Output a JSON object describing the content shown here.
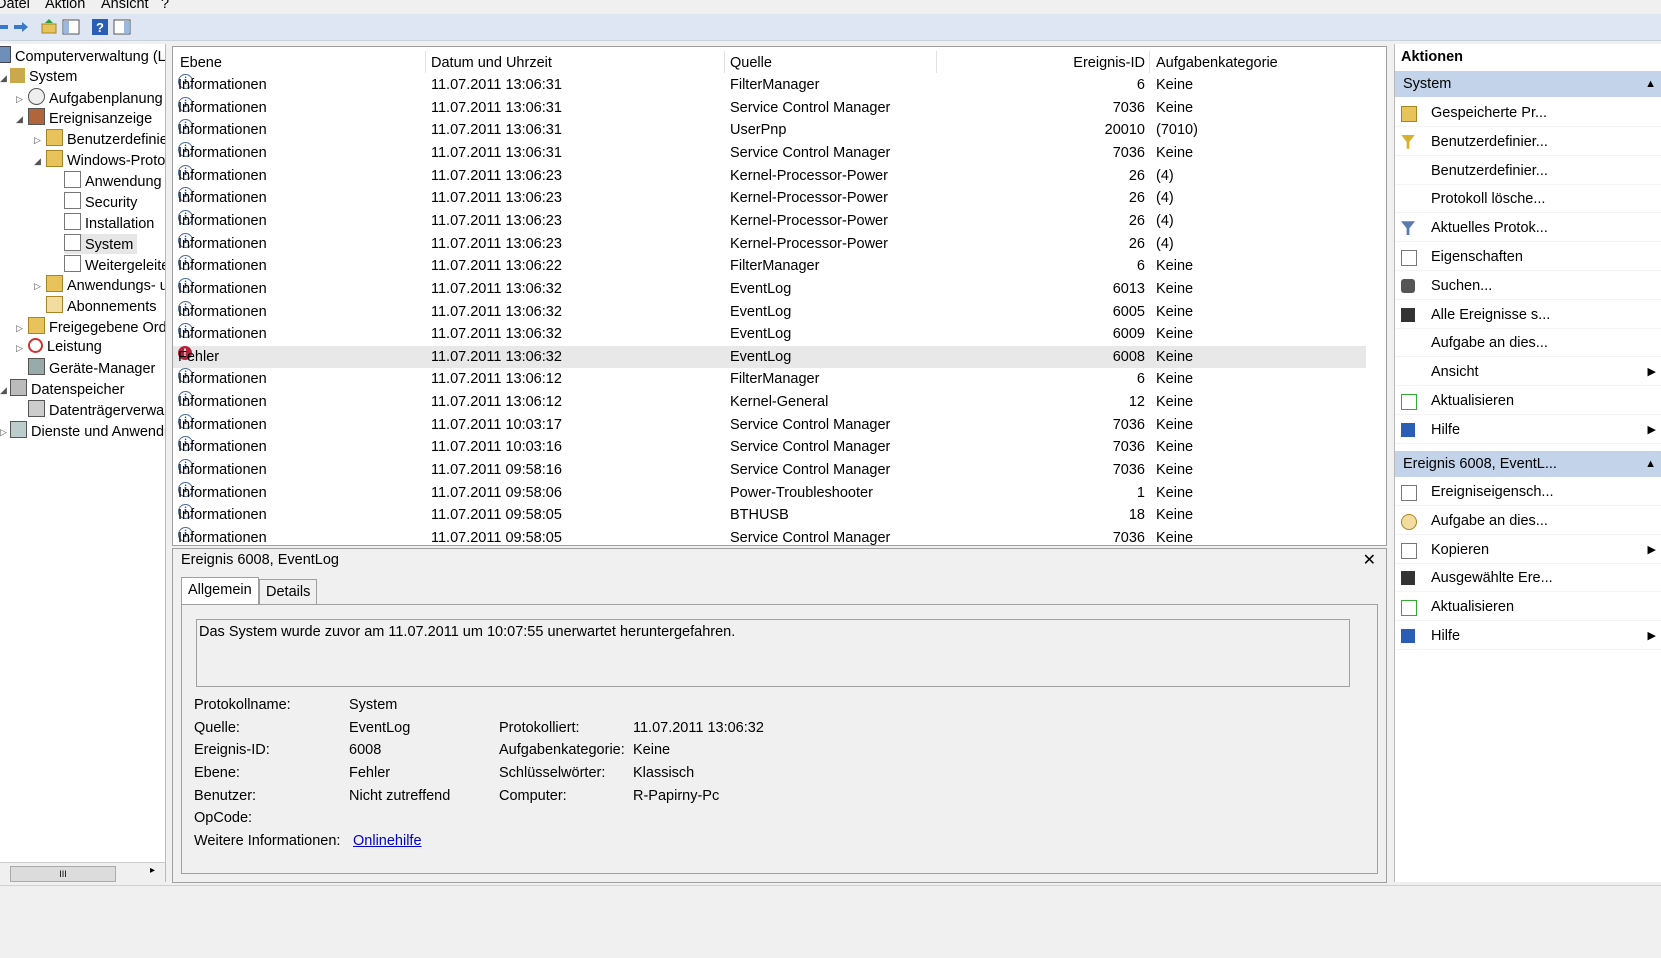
{
  "menu": {
    "file": "Datei",
    "action": "Aktion",
    "view": "Ansicht",
    "help": "?"
  },
  "tree": {
    "root": "Computerverwaltung (Lc",
    "system": "System",
    "task_scheduler": "Aufgabenplanung",
    "event_viewer": "Ereignisanzeige",
    "custom_views": "Benutzerdefinie",
    "windows_logs": "Windows-Protol",
    "application": "Anwendung",
    "security": "Security",
    "installation": "Installation",
    "system_log": "System",
    "forwarded": "Weitergeleite",
    "app_services": "Anwendungs- u",
    "subscriptions": "Abonnements",
    "shared_folders": "Freigegebene Ordr",
    "performance": "Leistung",
    "device_manager": "Geräte-Manager",
    "storage": "Datenspeicher",
    "disk_mgmt": "Datenträgerverwal",
    "services": "Dienste und Anwendu"
  },
  "list": {
    "columns": {
      "level": "Ebene",
      "datetime": "Datum und Uhrzeit",
      "source": "Quelle",
      "event_id": "Ereignis-ID",
      "task_category": "Aufgabenkategorie"
    },
    "rows": [
      {
        "level": "Informationen",
        "type": "info",
        "datetime": "11.07.2011 13:06:31",
        "source": "FilterManager",
        "id": "6",
        "category": "Keine"
      },
      {
        "level": "Informationen",
        "type": "info",
        "datetime": "11.07.2011 13:06:31",
        "source": "Service Control Manager",
        "id": "7036",
        "category": "Keine"
      },
      {
        "level": "Informationen",
        "type": "info",
        "datetime": "11.07.2011 13:06:31",
        "source": "UserPnp",
        "id": "20010",
        "category": "(7010)"
      },
      {
        "level": "Informationen",
        "type": "info",
        "datetime": "11.07.2011 13:06:31",
        "source": "Service Control Manager",
        "id": "7036",
        "category": "Keine"
      },
      {
        "level": "Informationen",
        "type": "info",
        "datetime": "11.07.2011 13:06:23",
        "source": "Kernel-Processor-Power",
        "id": "26",
        "category": "(4)"
      },
      {
        "level": "Informationen",
        "type": "info",
        "datetime": "11.07.2011 13:06:23",
        "source": "Kernel-Processor-Power",
        "id": "26",
        "category": "(4)"
      },
      {
        "level": "Informationen",
        "type": "info",
        "datetime": "11.07.2011 13:06:23",
        "source": "Kernel-Processor-Power",
        "id": "26",
        "category": "(4)"
      },
      {
        "level": "Informationen",
        "type": "info",
        "datetime": "11.07.2011 13:06:23",
        "source": "Kernel-Processor-Power",
        "id": "26",
        "category": "(4)"
      },
      {
        "level": "Informationen",
        "type": "info",
        "datetime": "11.07.2011 13:06:22",
        "source": "FilterManager",
        "id": "6",
        "category": "Keine"
      },
      {
        "level": "Informationen",
        "type": "info",
        "datetime": "11.07.2011 13:06:32",
        "source": "EventLog",
        "id": "6013",
        "category": "Keine"
      },
      {
        "level": "Informationen",
        "type": "info",
        "datetime": "11.07.2011 13:06:32",
        "source": "EventLog",
        "id": "6005",
        "category": "Keine"
      },
      {
        "level": "Informationen",
        "type": "info",
        "datetime": "11.07.2011 13:06:32",
        "source": "EventLog",
        "id": "6009",
        "category": "Keine"
      },
      {
        "level": "Fehler",
        "type": "error",
        "datetime": "11.07.2011 13:06:32",
        "source": "EventLog",
        "id": "6008",
        "category": "Keine"
      },
      {
        "level": "Informationen",
        "type": "info",
        "datetime": "11.07.2011 13:06:12",
        "source": "FilterManager",
        "id": "6",
        "category": "Keine"
      },
      {
        "level": "Informationen",
        "type": "info",
        "datetime": "11.07.2011 13:06:12",
        "source": "Kernel-General",
        "id": "12",
        "category": "Keine"
      },
      {
        "level": "Informationen",
        "type": "info",
        "datetime": "11.07.2011 10:03:17",
        "source": "Service Control Manager",
        "id": "7036",
        "category": "Keine"
      },
      {
        "level": "Informationen",
        "type": "info",
        "datetime": "11.07.2011 10:03:16",
        "source": "Service Control Manager",
        "id": "7036",
        "category": "Keine"
      },
      {
        "level": "Informationen",
        "type": "info",
        "datetime": "11.07.2011 09:58:16",
        "source": "Service Control Manager",
        "id": "7036",
        "category": "Keine"
      },
      {
        "level": "Informationen",
        "type": "info",
        "datetime": "11.07.2011 09:58:06",
        "source": "Power-Troubleshooter",
        "id": "1",
        "category": "Keine"
      },
      {
        "level": "Informationen",
        "type": "info",
        "datetime": "11.07.2011 09:58:05",
        "source": "BTHUSB",
        "id": "18",
        "category": "Keine"
      },
      {
        "level": "Informationen",
        "type": "info",
        "datetime": "11.07.2011 09:58:05",
        "source": "Service Control Manager",
        "id": "7036",
        "category": "Keine"
      }
    ]
  },
  "detail": {
    "title": "Ereignis 6008, EventLog",
    "tabs": {
      "general": "Allgemein",
      "details": "Details"
    },
    "message": "Das System wurde zuvor am 11.07.2011 um 10:07:55 unerwartet heruntergefahren.",
    "labels": {
      "log_name": "Protokollname:",
      "source": "Quelle:",
      "event_id": "Ereignis-ID:",
      "level": "Ebene:",
      "user": "Benutzer:",
      "opcode": "OpCode:",
      "more_info": "Weitere Informationen:",
      "logged": "Protokolliert:",
      "task_category": "Aufgabenkategorie:",
      "keywords": "Schlüsselwörter:",
      "computer": "Computer:"
    },
    "values": {
      "log_name": "System",
      "source": "EventLog",
      "event_id": "6008",
      "level": "Fehler",
      "user": "Nicht zutreffend",
      "logged": "11.07.2011 13:06:32",
      "task_category": "Keine",
      "keywords": "Klassisch",
      "computer": "R-Papirny-Pc",
      "online_help": "Onlinehilfe"
    }
  },
  "actions": {
    "title": "Aktionen",
    "section1": "System",
    "items1": [
      "Gespeicherte Pr...",
      "Benutzerdefinier...",
      "Benutzerdefinier...",
      "Protokoll lösche...",
      "Aktuelles Protok...",
      "Eigenschaften",
      "Suchen...",
      "Alle Ereignisse s...",
      "Aufgabe an dies...",
      "Ansicht",
      "Aktualisieren",
      "Hilfe"
    ],
    "section2": "Ereignis 6008, EventL...",
    "items2": [
      "Ereigniseigensch...",
      "Aufgabe an dies...",
      "Kopieren",
      "Ausgewählte Ere...",
      "Aktualisieren",
      "Hilfe"
    ]
  },
  "colors": {
    "accent": "#c2d3ea",
    "error": "#b3213a",
    "link": "#0000cc"
  }
}
